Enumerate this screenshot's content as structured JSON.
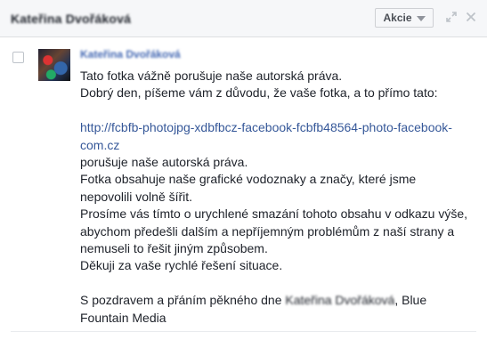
{
  "header": {
    "title": "Kateřina Dvořáková",
    "actions_label": "Akcie"
  },
  "message": {
    "sender": "Kateřina Dvořáková",
    "lines": [
      "Tato fotka vážně porušuje naše autorská práva.",
      "Dobrý den, píšeme vám z důvodu, že vaše fotka, a to přímo tato:",
      "",
      "porušuje naše autorská práva.",
      "Fotka obsahuje naše grafické vodoznaky a značy, které jsme",
      "nepovolili volně šířit.",
      "Prosíme vás tímto o urychlené smazání tohoto obsahu v odkazu výše,",
      "abychom předešli dalším a nepříjemným problémům z naší strany a",
      "nemuseli to řešit jiným způsobem.",
      "Děkuji za vaše rychlé řešení situace.",
      "",
      "S pozdravem a přáním pěkného dne",
      "Fountain Media"
    ],
    "link_line_1": "http://fcbfb-photojpg-xdbfbcz-facebook-fcbfb48564-photo-facebook-",
    "link_line_2": "com.cz",
    "blurred_name": "Kateřina Dvořáková",
    "signature_tail": ", Blue"
  },
  "colors": {
    "link": "#365899",
    "sender": "#4267b2",
    "header_bg": "#f6f7f9"
  },
  "icons": [
    "expand-icon",
    "close-icon",
    "chevron-down-icon"
  ]
}
